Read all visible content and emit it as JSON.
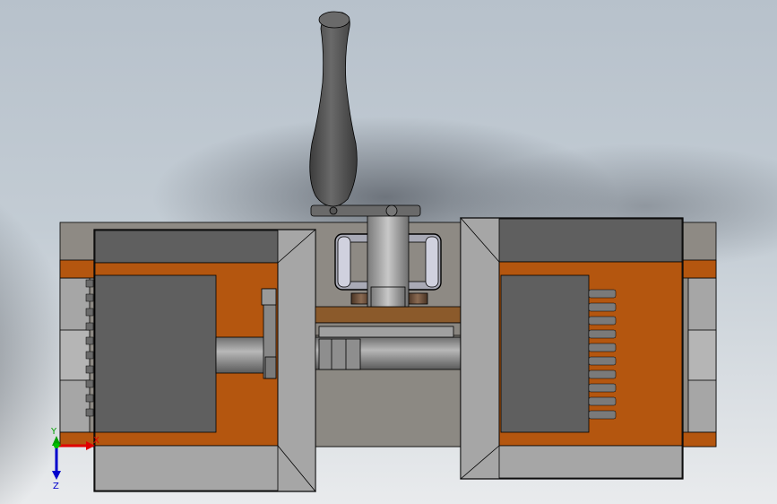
{
  "viewport": {
    "background_top": "#b4bec9",
    "background_bottom": "#eceef0"
  },
  "colors": {
    "section_orange": "#b4560f",
    "housing_gray": "#8e8a84",
    "dark_gray": "#5f5f5f",
    "light_gray": "#a6a6a6",
    "handle": "#4f4f4f",
    "axis_x": "#e00000",
    "axis_y": "#00a000",
    "axis_z": "#0000cc"
  },
  "triad": {
    "x_label": "X",
    "y_label": "Y",
    "z_label": "Z"
  }
}
